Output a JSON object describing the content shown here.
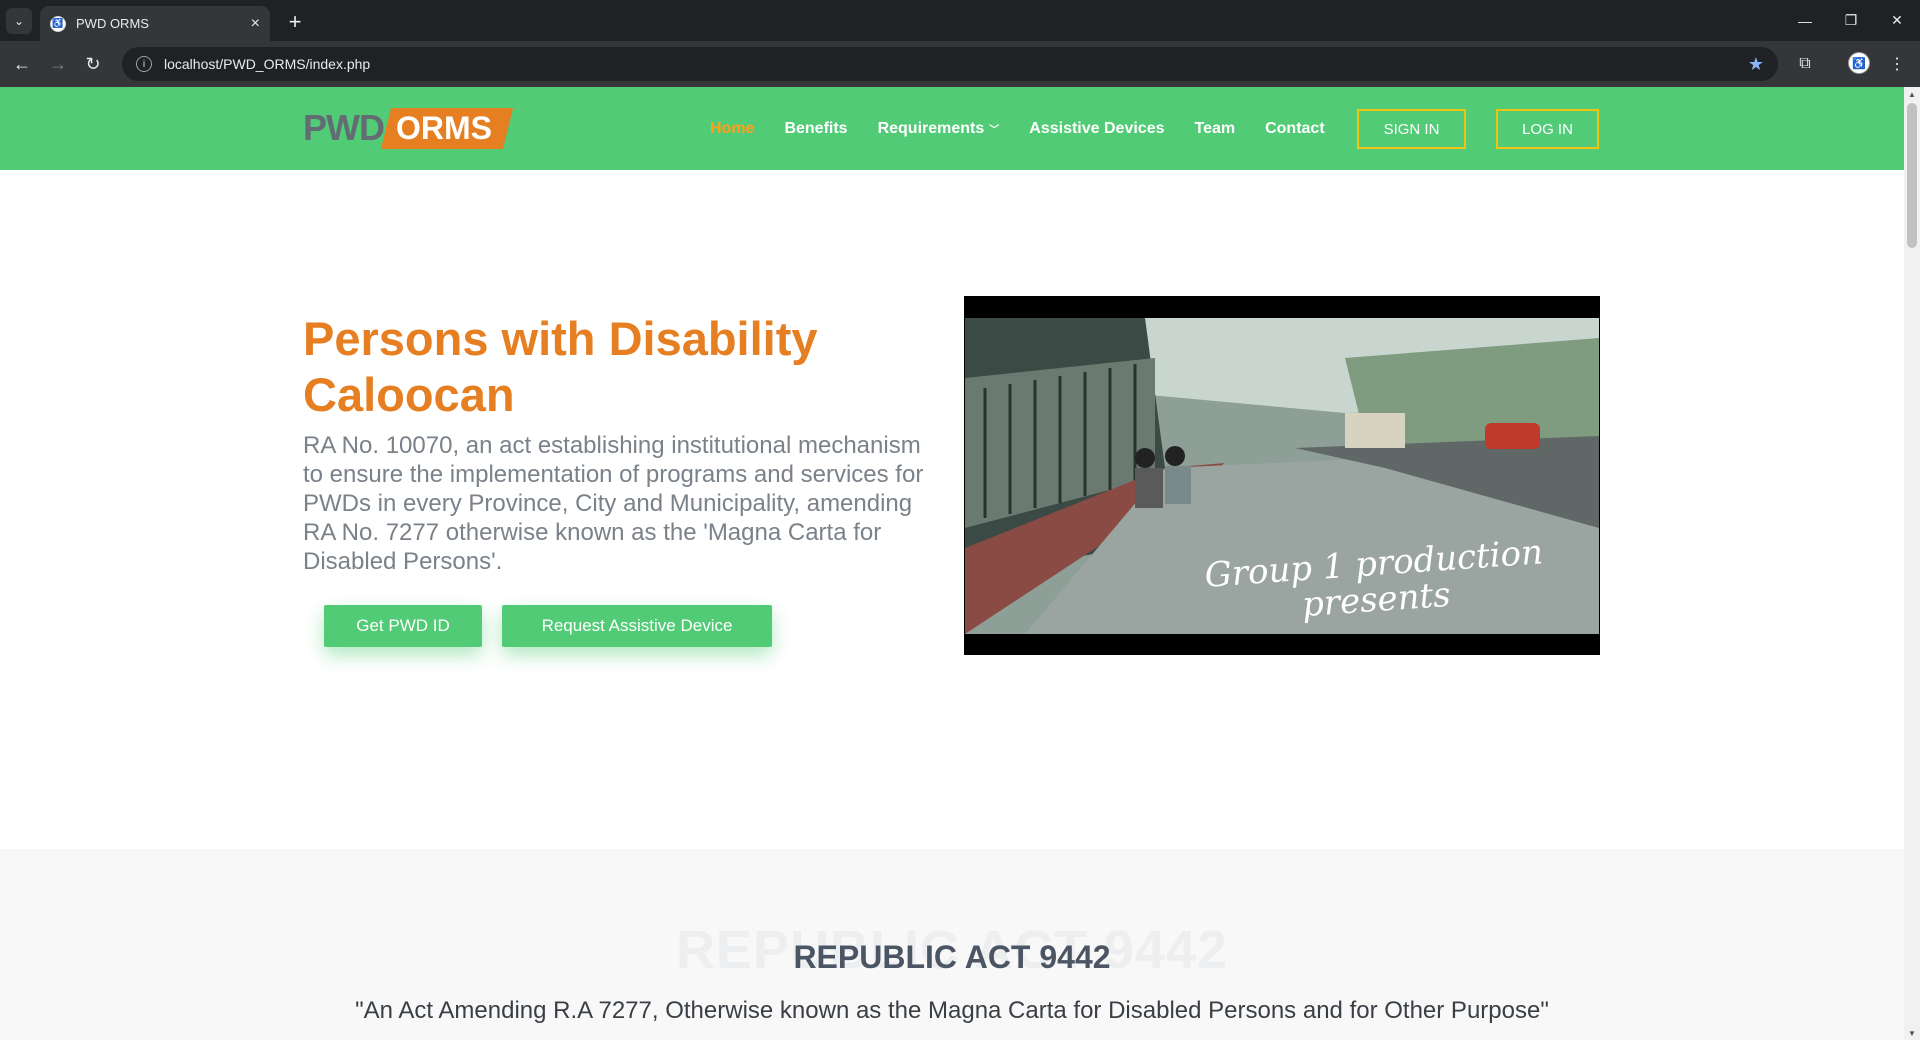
{
  "browser": {
    "tab_title": "PWD ORMS",
    "url": "localhost/PWD_ORMS/index.php"
  },
  "site": {
    "logo": {
      "part1": "PWD",
      "part2": "ORMS"
    },
    "nav": {
      "home": "Home",
      "benefits": "Benefits",
      "requirements": "Requirements",
      "assistive_devices": "Assistive Devices",
      "team": "Team",
      "contact": "Contact",
      "sign_in": "SIGN IN",
      "log_in": "LOG IN"
    },
    "colors": {
      "header_green": "#52cb77",
      "accent_orange": "#e67e22",
      "active_nav": "#ff9f1a",
      "outline_yellow": "#f1c40f"
    }
  },
  "hero": {
    "title": "Persons with Disability Caloocan",
    "description": "RA No. 10070, an act establishing institutional mechanism to ensure the implementation of programs and services for PWDs in every Province, City and Municipality, amending RA No. 7277 otherwise known as the 'Magna Carta for Disabled Persons'.",
    "btn_pwd_id": "Get PWD ID",
    "btn_assistive": "Request Assistive Device",
    "video_caption": "Group 1 production presents"
  },
  "section_ra": {
    "ghost_title": "REPUBLIC ACT 9442",
    "title": "REPUBLIC ACT 9442",
    "subtitle": "\"An Act Amending R.A 7277, Otherwise known as the Magna Carta for Disabled Persons and for Other Purpose\""
  }
}
